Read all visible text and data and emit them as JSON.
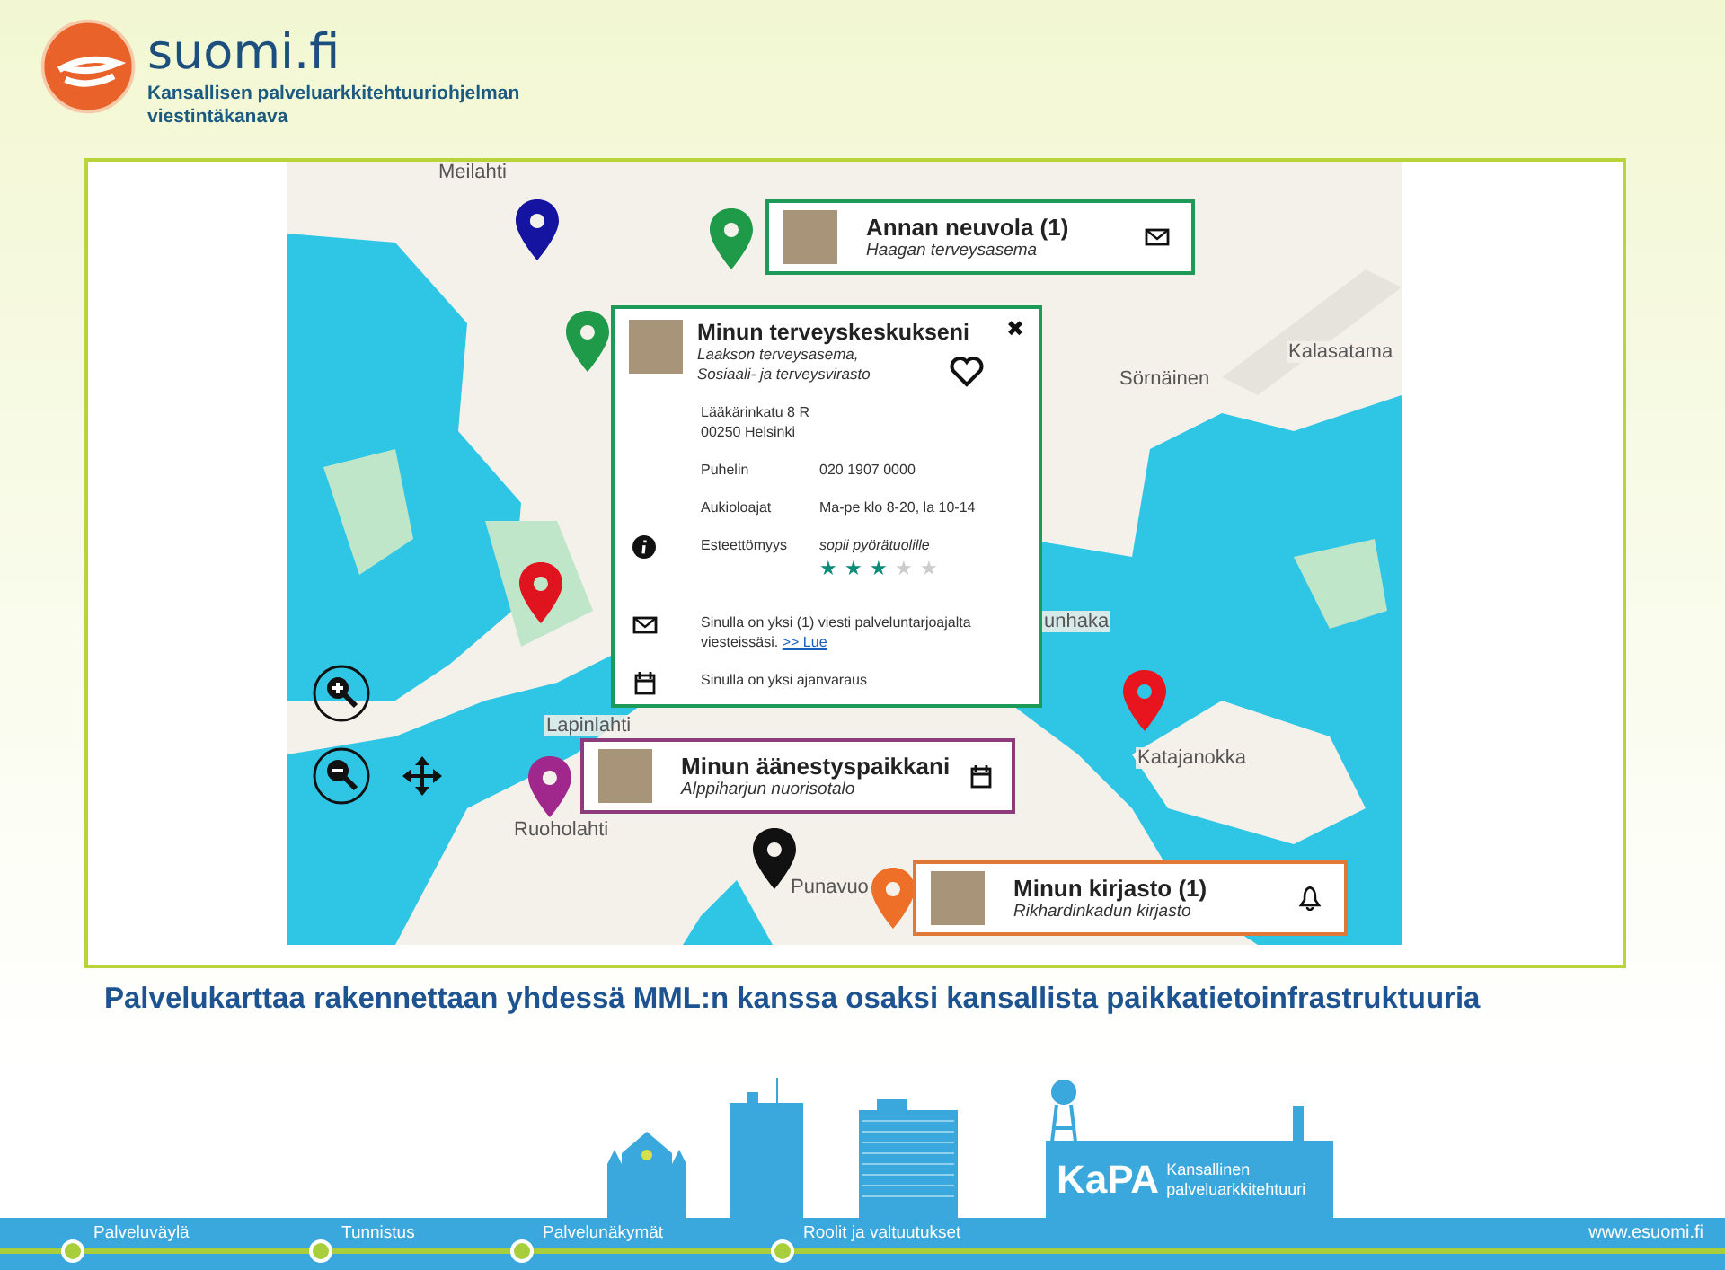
{
  "header": {
    "logo_text": "suomi.fi",
    "subtitle_lines": [
      "Kansallisen palveluarkkitehtuuriohjelman",
      "viestintäkanava"
    ]
  },
  "map": {
    "places": [
      "Meilahti",
      "Sörnäinen",
      "Kalasatama",
      "unhaka",
      "Lapinlahti",
      "Ruoholahti",
      "Punavuo",
      "Katajanokka"
    ],
    "pins": [
      {
        "color": "#1414a0"
      },
      {
        "color": "#1e9a48"
      },
      {
        "color": "#1e9a48"
      },
      {
        "color": "#e0141e"
      },
      {
        "color": "#e8141e"
      },
      {
        "color": "#a0288c"
      },
      {
        "color": "#111111"
      },
      {
        "color": "#ee7028"
      }
    ],
    "cards": [
      {
        "title": "Annan neuvola  (1)",
        "subtitle": "Haagan terveysasema",
        "color": "#1e9a58",
        "kind": "mail"
      },
      {
        "title": "Minun äänestyspaikkani",
        "subtitle": "Alppiharjun nuorisotalo",
        "color": "#8c3c7c",
        "kind": "calendar"
      },
      {
        "title": "Minun kirjasto (1)",
        "subtitle": "Rikhardinkadun kirjasto",
        "color": "#e07838",
        "kind": "bell"
      }
    ],
    "detail": {
      "title": "Minun terveyskeskukseni",
      "close": "✖",
      "subtitle_lines": [
        "Laakson terveysasema,",
        "Sosiaali- ja terveysvirasto"
      ],
      "address_lines": [
        "Lääkärinkatu 8 R",
        "00250 Helsinki"
      ],
      "rows": [
        {
          "label": "Puhelin",
          "value": "020  1907 0000"
        },
        {
          "label": "Aukioloajat",
          "value": "Ma-pe klo 8-20, la 10-14"
        },
        {
          "label": "Esteettömyys",
          "value": "sopii pyörätuolille",
          "stars": 3
        }
      ],
      "message": {
        "text": "Sinulla on yksi (1) viesti palveluntarjoajalta viesteissäsi.",
        "link": ">> Lue"
      },
      "booking": "Sinulla on yksi ajanvaraus"
    }
  },
  "caption": "Palvelukarttaa rakennettaan yhdessä MML:n kanssa osaksi kansallista paikkatietoinfrastruktuuria",
  "footer": {
    "kapa": {
      "logo": "KaPA",
      "lines": [
        "Kansallinen",
        "palveluarkkitehtuuri"
      ]
    },
    "stops": [
      "Palveluväylä",
      "Tunnistus",
      "Palvelunäkymät",
      "Roolit ja valtuutukset"
    ],
    "url": "www.esuomi.fi"
  }
}
